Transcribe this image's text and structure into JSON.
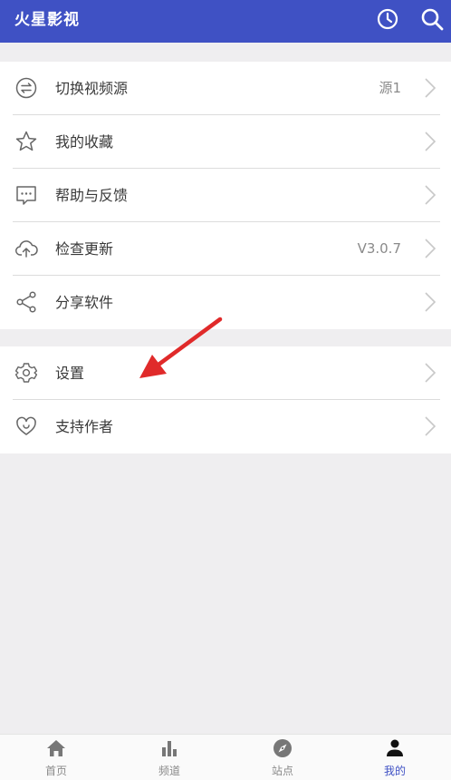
{
  "app": {
    "title": "火星影视"
  },
  "menu_group_1": [
    {
      "label": "切换视频源",
      "value": "源1",
      "icon": "swap-icon"
    },
    {
      "label": "我的收藏",
      "value": "",
      "icon": "star-icon"
    },
    {
      "label": "帮助与反馈",
      "value": "",
      "icon": "chat-bubble-icon"
    },
    {
      "label": "检查更新",
      "value": "V3.0.7",
      "icon": "cloud-upload-icon"
    },
    {
      "label": "分享软件",
      "value": "",
      "icon": "share-icon"
    }
  ],
  "menu_group_2": [
    {
      "label": "设置",
      "icon": "gear-icon"
    },
    {
      "label": "支持作者",
      "icon": "heart-icon"
    }
  ],
  "tabs": [
    {
      "label": "首页",
      "icon": "home-icon"
    },
    {
      "label": "频道",
      "icon": "bar-chart-icon"
    },
    {
      "label": "站点",
      "icon": "compass-icon"
    },
    {
      "label": "我的",
      "icon": "person-icon"
    }
  ],
  "colors": {
    "primary": "#3f51c4",
    "arrow": "#e02a2a",
    "background": "#efeef0"
  }
}
